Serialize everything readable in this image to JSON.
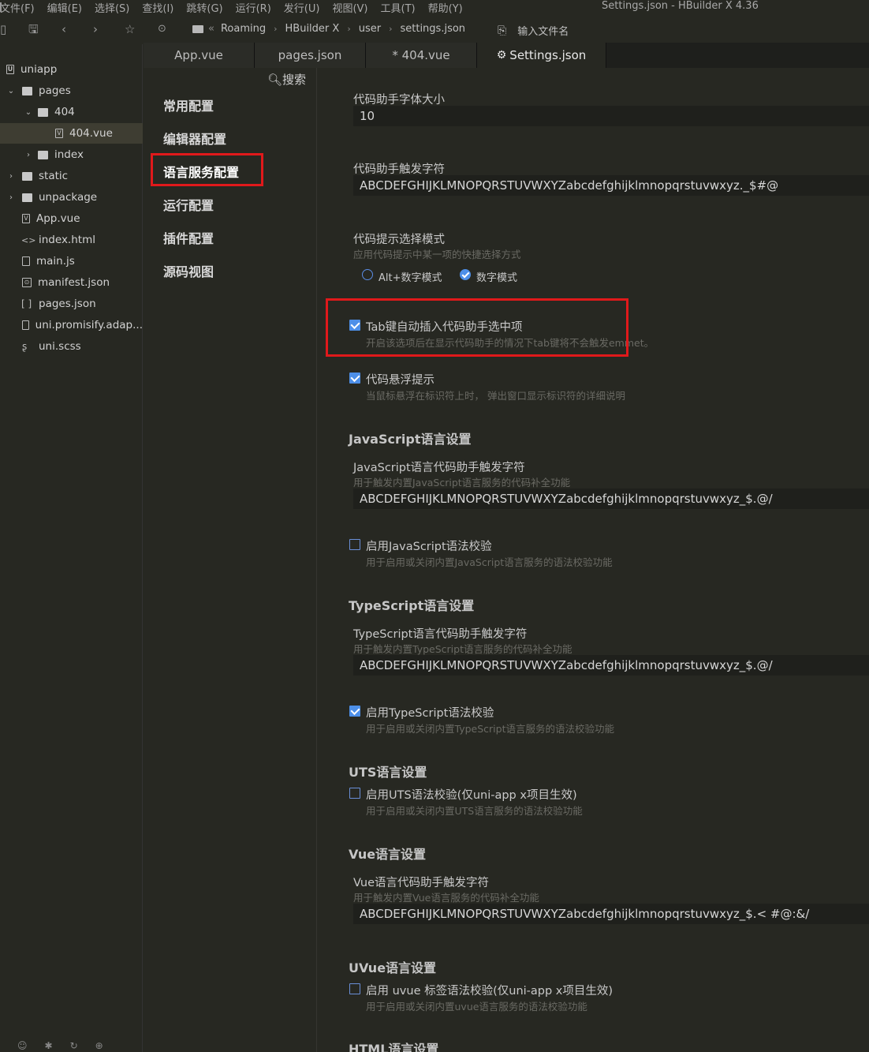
{
  "window_title": "Settings.json - HBuilder X 4.36",
  "menu": [
    "文件(F)",
    "编辑(E)",
    "选择(S)",
    "查找(I)",
    "跳转(G)",
    "运行(R)",
    "发行(U)",
    "视图(V)",
    "工具(T)",
    "帮助(Y)"
  ],
  "breadcrumb": [
    "Roaming",
    "HBuilder X",
    "user",
    "settings.json"
  ],
  "breadcrumb_prefix": "«",
  "file_search_placeholder": "输入文件名",
  "tree": [
    {
      "label": "uniapp",
      "icon": "project-icon"
    },
    {
      "label": "pages",
      "icon": "folder-icon",
      "expanded": true
    },
    {
      "label": "404",
      "icon": "folder-icon",
      "expanded": true
    },
    {
      "label": "404.vue",
      "icon": "vue-file-icon",
      "selected": true
    },
    {
      "label": "index",
      "icon": "folder-icon",
      "expanded": false
    },
    {
      "label": "static",
      "icon": "folder-icon",
      "expanded": false
    },
    {
      "label": "unpackage",
      "icon": "folder-icon",
      "expanded": false
    },
    {
      "label": "App.vue",
      "icon": "vue-file-icon"
    },
    {
      "label": "index.html",
      "icon": "html-file-icon"
    },
    {
      "label": "main.js",
      "icon": "js-file-icon"
    },
    {
      "label": "manifest.json",
      "icon": "manifest-file-icon"
    },
    {
      "label": "pages.json",
      "icon": "json-file-icon"
    },
    {
      "label": "uni.promisify.adap...",
      "icon": "js-file-icon"
    },
    {
      "label": "uni.scss",
      "icon": "scss-file-icon"
    }
  ],
  "tabs": [
    {
      "label": "App.vue"
    },
    {
      "label": "pages.json"
    },
    {
      "label": "* 404.vue"
    },
    {
      "label": "Settings.json",
      "active": true
    }
  ],
  "settings_search": "搜索",
  "settings_nav": [
    "常用配置",
    "编辑器配置",
    "语言服务配置",
    "运行配置",
    "插件配置",
    "源码视图"
  ],
  "settings": {
    "font_size_label": "代码助手字体大小",
    "font_size_value": "10",
    "trigger_label": "代码助手触发字符",
    "trigger_value": "ABCDEFGHIJKLMNOPQRSTUVWXYZabcdefghijklmnopqrstuvwxyz._$#@",
    "select_mode_label": "代码提示选择模式",
    "select_mode_desc": "应用代码提示中某一项的快捷选择方式",
    "mode_alt": "Alt+数字模式",
    "mode_num": "数字模式",
    "tab_insert_label": "Tab键自动插入代码助手选中项",
    "tab_insert_desc": "开启该选项后在显示代码助手的情况下tab键将不会触发emmet。",
    "hover_label": "代码悬浮提示",
    "hover_desc": "当鼠标悬浮在标识符上时， 弹出窗口显示标识符的详细说明",
    "js_header": "JavaScript语言设置",
    "js_trigger_label": "JavaScript语言代码助手触发字符",
    "js_trigger_desc": "用于触发内置JavaScript语言服务的代码补全功能",
    "js_trigger_value": "ABCDEFGHIJKLMNOPQRSTUVWXYZabcdefghijklmnopqrstuvwxyz_$.@/",
    "js_lint_label": "启用JavaScript语法校验",
    "js_lint_desc": "用于启用或关闭内置JavaScript语言服务的语法校验功能",
    "ts_header": "TypeScript语言设置",
    "ts_trigger_label": "TypeScript语言代码助手触发字符",
    "ts_trigger_desc": "用于触发内置TypeScript语言服务的代码补全功能",
    "ts_trigger_value": "ABCDEFGHIJKLMNOPQRSTUVWXYZabcdefghijklmnopqrstuvwxyz_$.@/",
    "ts_lint_label": "启用TypeScript语法校验",
    "ts_lint_desc": "用于启用或关闭内置TypeScript语言服务的语法校验功能",
    "uts_header": "UTS语言设置",
    "uts_lint_label": "启用UTS语法校验(仅uni-app x项目生效)",
    "uts_lint_desc": "用于启用或关闭内置UTS语言服务的语法校验功能",
    "vue_header": "Vue语言设置",
    "vue_trigger_label": "Vue语言代码助手触发字符",
    "vue_trigger_desc": "用于触发内置Vue语言服务的代码补全功能",
    "vue_trigger_value": "ABCDEFGHIJKLMNOPQRSTUVWXYZabcdefghijklmnopqrstuvwxyz_$.< #@:&/",
    "uvue_header": "UVue语言设置",
    "uvue_lint_label": "启用 uvue 标签语法校验(仅uni-app x项目生效)",
    "uvue_lint_desc": "用于启用或关闭内置uvue语言服务的语法校验功能",
    "html_header": "HTML语言设置"
  },
  "states": {
    "select_mode": "数字模式",
    "tab_insert": true,
    "hover": true,
    "js_lint": false,
    "ts_lint": true,
    "uts_lint": false,
    "uvue_lint": false
  },
  "colors": {
    "accent": "#4d8fe8",
    "highlight_box": "#e0191b"
  }
}
